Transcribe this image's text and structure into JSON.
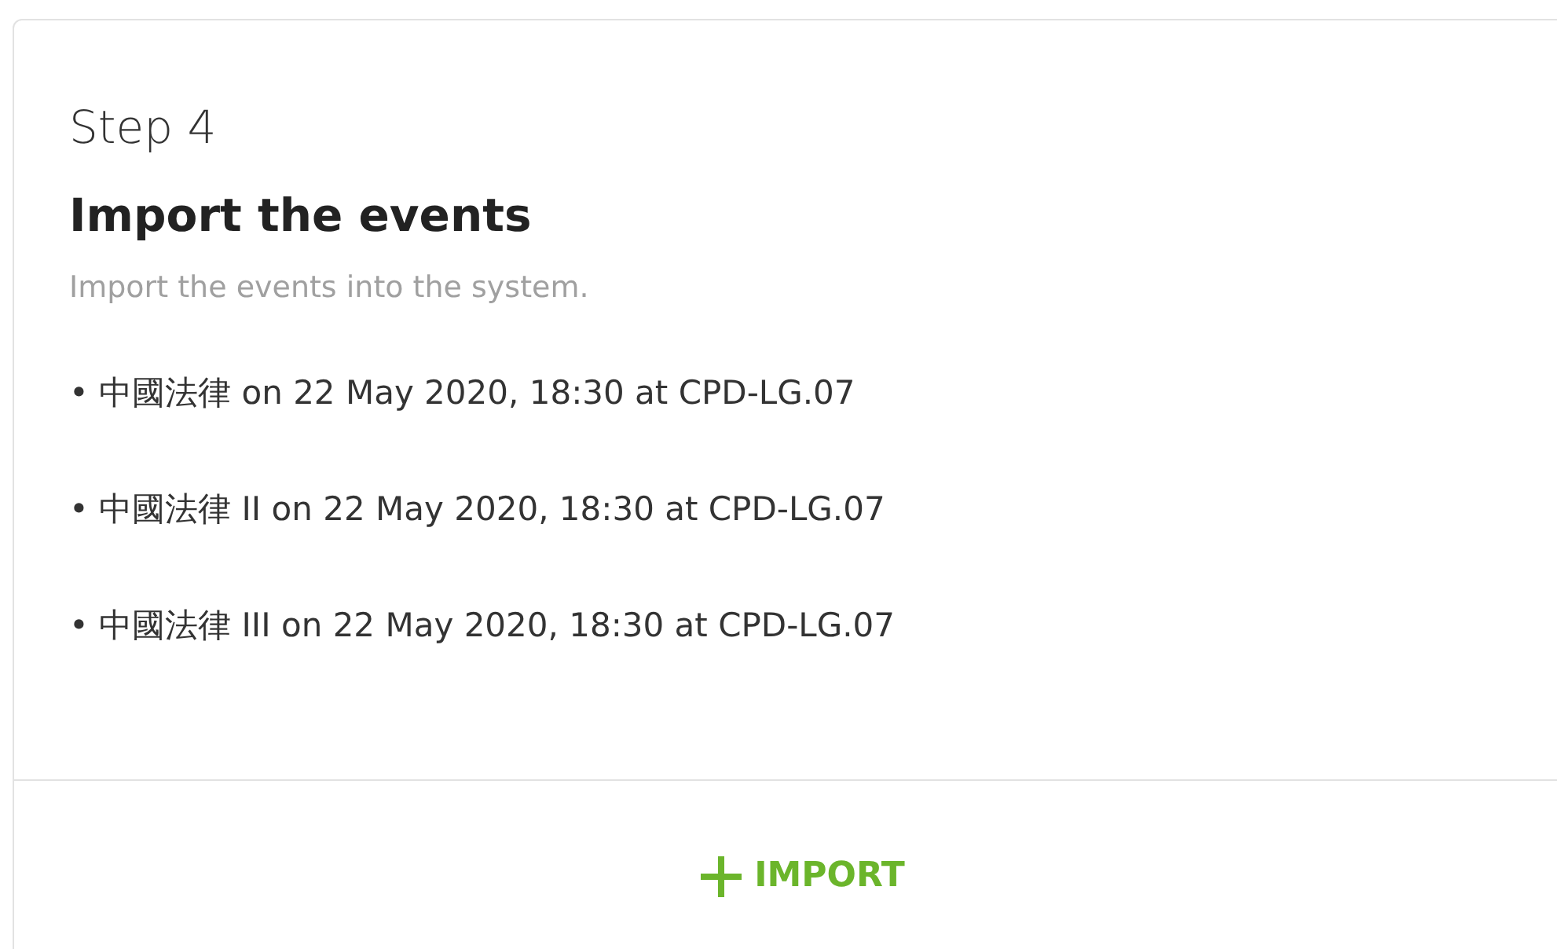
{
  "step": "Step 4",
  "title": "Import the events",
  "subtitle": "Import the events into the system.",
  "events": [
    {
      "text": "• 中國法律 on 22 May 2020, 18:30 at CPD-LG.07"
    },
    {
      "text": "• 中國法律 II on 22 May 2020, 18:30 at CPD-LG.07"
    },
    {
      "text": "• 中國法律 III on 22 May 2020, 18:30 at CPD-LG.07"
    }
  ],
  "button": {
    "label": "IMPORT"
  }
}
